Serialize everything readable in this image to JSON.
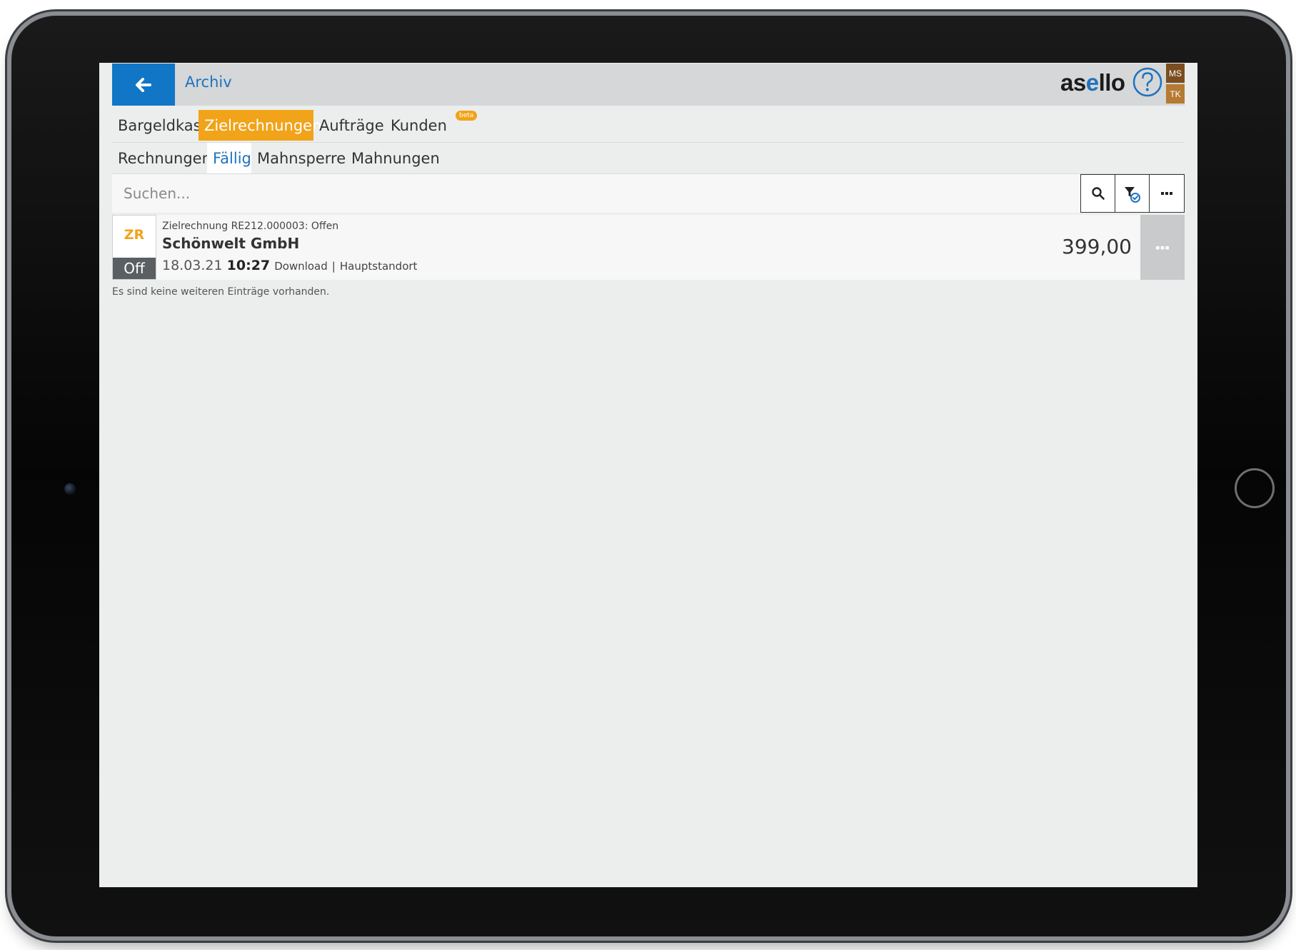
{
  "header": {
    "title": "Archiv",
    "logo_prefix": "as",
    "logo_accent": "e",
    "logo_suffix": "llo",
    "users": [
      "MS",
      "TK"
    ]
  },
  "tabs": [
    {
      "label": "Bargeldkasse",
      "active": false
    },
    {
      "label": "Zielrechnungen",
      "active": true
    },
    {
      "label": "Aufträge",
      "active": false
    },
    {
      "label": "Kunden",
      "active": false,
      "badge": "beta"
    }
  ],
  "subtabs": [
    {
      "label": "Rechnungen",
      "active": false
    },
    {
      "label": "Fällig",
      "active": true
    },
    {
      "label": "Mahnsperre",
      "active": false
    },
    {
      "label": "Mahnungen",
      "active": false
    }
  ],
  "search": {
    "placeholder": "Suchen..."
  },
  "list": {
    "items": [
      {
        "type_code": "ZR",
        "status_short": "Off",
        "subtitle": "Zielrechnung RE212.000003: Offen",
        "title": "Schönwelt GmbH",
        "date": "18.03.21",
        "time": "10:27",
        "source": "Download",
        "separator": "|",
        "location": "Hauptstandort",
        "amount": "399,00"
      }
    ],
    "empty_note": "Es sind keine weiteren Einträge vorhanden."
  },
  "colors": {
    "primary": "#1176c6",
    "accent": "#f1a319",
    "header_bg": "#d5d7d8",
    "screen_bg": "#eceeed"
  }
}
